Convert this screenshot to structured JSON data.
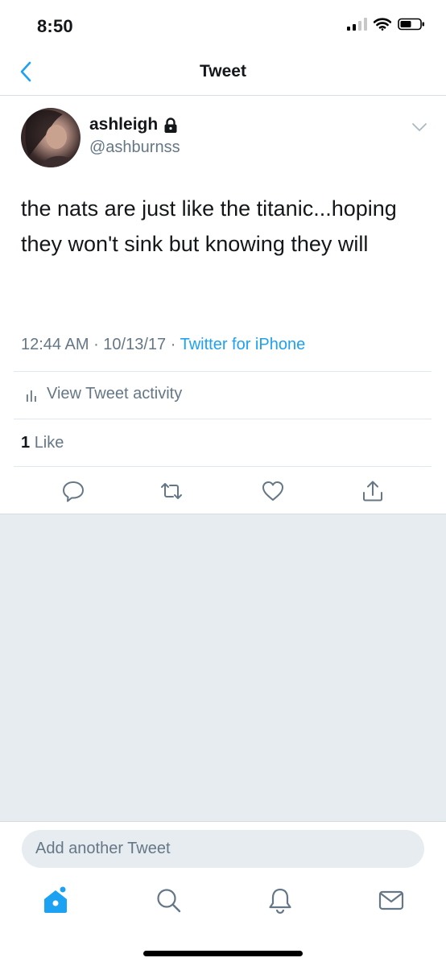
{
  "status_bar": {
    "time": "8:50"
  },
  "nav": {
    "title": "Tweet"
  },
  "tweet": {
    "user_name": "ashleigh",
    "user_handle": "@ashburnss",
    "text": "the nats are just like the titanic...hoping they won't sink but knowing they will",
    "time": "12:44 AM",
    "date": "10/13/17",
    "source": "Twitter for iPhone",
    "activity_label": "View Tweet activity",
    "like_count": "1",
    "like_label": "Like"
  },
  "compose": {
    "placeholder": "Add another Tweet"
  },
  "colors": {
    "accent": "#1da1f2",
    "secondary_text": "#657786",
    "background_grey": "#e6ecf0"
  },
  "icons": {
    "actions": [
      "reply-icon",
      "retweet-icon",
      "like-icon",
      "share-icon"
    ],
    "tabs": [
      "home-icon",
      "search-icon",
      "notifications-icon",
      "messages-icon"
    ]
  }
}
